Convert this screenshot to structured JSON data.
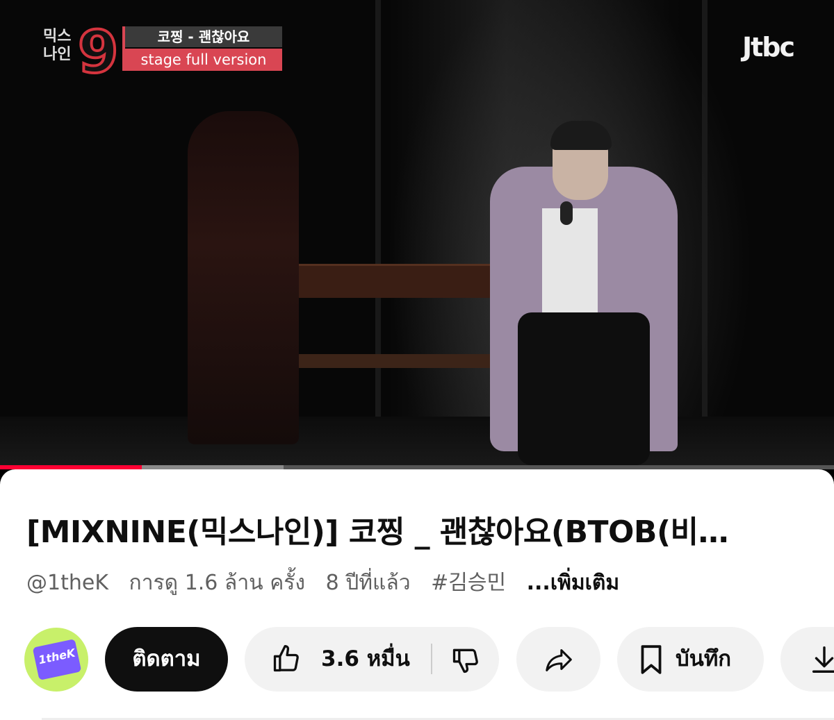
{
  "video": {
    "overlay_show_name": "믹스\n나인",
    "overlay_nine": "9",
    "overlay_title": "코찡 - 괜찮아요",
    "overlay_subtitle": "stage full version",
    "broadcaster_logo": "Jtbc",
    "progress_played": 0.17,
    "progress_buffered": 0.34,
    "colors": {
      "progress": "#ff0033",
      "accent": "#d94653"
    }
  },
  "info": {
    "title": "[MIXNINE(믹스나인)] 코찡 _ 괜찮아요(BTOB(비…",
    "channel_handle": "@1theK",
    "views": "การดู 1.6 ล้าน ครั้ง",
    "age": "8 ปีที่แล้ว",
    "hashtag": "#김승민",
    "more_label": "...เพิ่มเติม"
  },
  "actions": {
    "avatar_text": "1theK",
    "subscribe_label": "ติดตาม",
    "like_count": "3.6 หมื่น",
    "save_label": "บันทึก",
    "icons": [
      "thumbs-up-icon",
      "thumbs-down-icon",
      "share-icon",
      "bookmark-icon",
      "download-icon"
    ]
  }
}
